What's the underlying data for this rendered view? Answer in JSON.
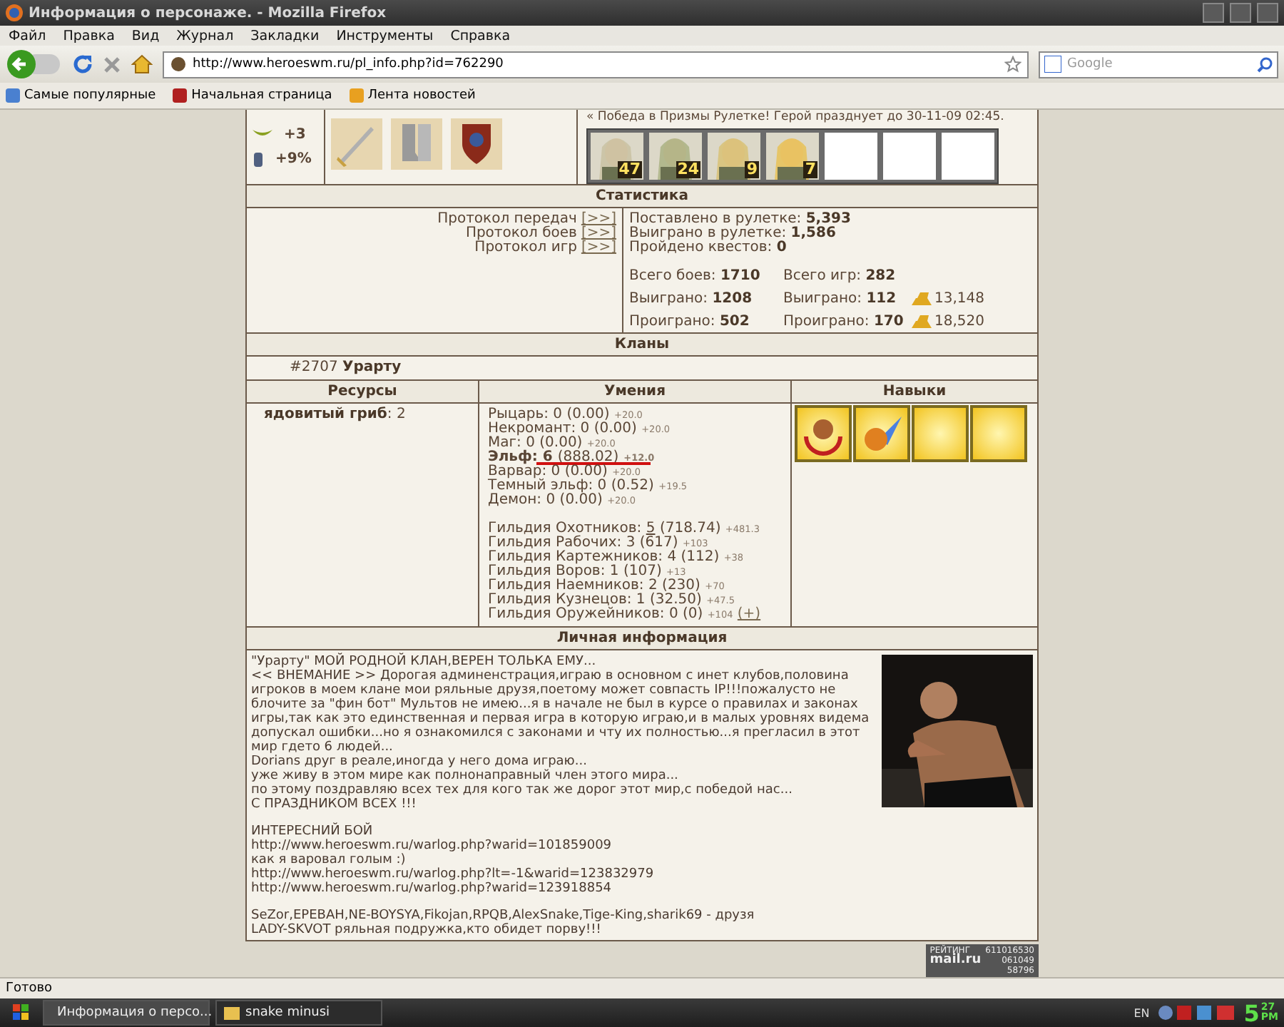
{
  "window": {
    "title": "Информация о персонаже. - Mozilla Firefox"
  },
  "menu": [
    "Файл",
    "Правка",
    "Вид",
    "Журнал",
    "Закладки",
    "Инструменты",
    "Справка"
  ],
  "nav": {
    "url": "http://www.heroeswm.ru/pl_info.php?id=762290",
    "search_placeholder": "Google"
  },
  "bookmarks": [
    "Самые популярные",
    "Начальная страница",
    "Лента новостей"
  ],
  "hero": {
    "bonuses": [
      {
        "kind": "wings",
        "value": "+3"
      },
      {
        "kind": "jar",
        "value": "+9%"
      }
    ],
    "items": [
      {
        "kind": "sword"
      },
      {
        "kind": "boots"
      },
      {
        "kind": "shield"
      }
    ],
    "news": "« Победа в Призмы Рулетке! Герой празднует до 30-11-09 02:45.",
    "army": [
      {
        "kind": "creature",
        "count": "47"
      },
      {
        "kind": "creature",
        "count": "24"
      },
      {
        "kind": "creature",
        "count": "9"
      },
      {
        "kind": "creature",
        "count": "7"
      },
      {
        "kind": "empty"
      },
      {
        "kind": "empty"
      },
      {
        "kind": "empty"
      }
    ]
  },
  "statistics": {
    "title": "Статистика",
    "links": [
      {
        "label": "Протокол передач",
        "button": "[>>]"
      },
      {
        "label": "Протокол боев",
        "button": "[>>]"
      },
      {
        "label": "Протокол игр",
        "button": "[>>]"
      }
    ],
    "roulette": [
      {
        "label": "Поставлено в рулетке:",
        "value": "5,393"
      },
      {
        "label": "Выиграно в рулетке:",
        "value": "1,586"
      },
      {
        "label": "Пройдено квестов:",
        "value": "0"
      }
    ],
    "battles": [
      {
        "cells": [
          {
            "label": "Всего боев:",
            "value": "1710"
          },
          {
            "label": "Всего игр:",
            "value": "282"
          }
        ]
      },
      {
        "cells": [
          {
            "label": "Выиграно:",
            "value": "1208"
          },
          {
            "label": "Выиграно:",
            "value": "112"
          }
        ],
        "gold": "13,148"
      },
      {
        "cells": [
          {
            "label": "Проиграно:",
            "value": "502"
          },
          {
            "label": "Проиграно:",
            "value": "170"
          }
        ],
        "gold": "18,520"
      }
    ]
  },
  "clans": {
    "title": "Кланы",
    "items": [
      {
        "id": "#2707",
        "name": "Урарту"
      }
    ]
  },
  "resources": {
    "title": "Ресурсы",
    "items": [
      {
        "name": "ядовитый гриб",
        "value": ": 2"
      }
    ]
  },
  "skills": {
    "title": "Умения",
    "factions": [
      {
        "name": "Рыцарь:",
        "level": "0",
        "points": "(0.00)",
        "bonus": "+20.0",
        "current": false
      },
      {
        "name": "Некромант:",
        "level": "0",
        "points": "(0.00)",
        "bonus": "+20.0",
        "current": false
      },
      {
        "name": "Маг:",
        "level": "0",
        "points": "(0.00)",
        "bonus": "+20.0",
        "current": false
      },
      {
        "name": "Эльф:",
        "level": "6",
        "points": "(888.02)",
        "bonus": "+12.0",
        "current": true
      },
      {
        "name": "Варвар:",
        "level": "0",
        "points": "(0.00)",
        "bonus": "+20.0",
        "current": false
      },
      {
        "name": "Темный эльф:",
        "level": "0",
        "points": "(0.52)",
        "bonus": "+19.5",
        "current": false
      },
      {
        "name": "Демон:",
        "level": "0",
        "points": "(0.00)",
        "bonus": "+20.0",
        "current": false
      }
    ],
    "guilds": [
      {
        "name": "Гильдия Охотников:",
        "level": "5",
        "points": "(718.74)",
        "bonus": "+481.3",
        "linked": true
      },
      {
        "name": "Гильдия Рабочих:",
        "level": "3",
        "points": "(617)",
        "bonus": "+103",
        "linked": false
      },
      {
        "name": "Гильдия Картежников:",
        "level": "4",
        "points": "(112)",
        "bonus": "+38",
        "linked": false
      },
      {
        "name": "Гильдия Воров:",
        "level": "1",
        "points": "(107)",
        "bonus": "+13",
        "linked": false
      },
      {
        "name": "Гильдия Наемников:",
        "level": "2",
        "points": "(230)",
        "bonus": "+70",
        "linked": false
      },
      {
        "name": "Гильдия Кузнецов:",
        "level": "1",
        "points": "(32.50)",
        "bonus": "+47.5",
        "linked": false
      },
      {
        "name": "Гильдия Оружейников:",
        "level": "0",
        "points": "(0)",
        "bonus": "+104",
        "linked": false,
        "action": "(+)"
      }
    ]
  },
  "abilities": {
    "title": "Навыки",
    "slots": [
      {
        "kind": "emblem"
      },
      {
        "kind": "fireball"
      },
      {
        "kind": "empty"
      },
      {
        "kind": "empty"
      }
    ]
  },
  "personal": {
    "title": "Личная информация",
    "photo": {
      "kind": "picture"
    },
    "paragraphs": [
      [
        "\"Урарту\" МОЙ РОДНОЙ КЛАН,ВЕРЕН ТОЛЬКА ЕМУ...",
        "<< ВНЕМАНИЕ >> Дорогая админенстрация,играю в основном с инет клубов,половина игроков в моем клане мои ряльные друзя,поетому может совпасть IP!!!пожалусто не блочите за \"фин бот\" Мультов не имею...я в начале не был в курсе о правилах и законах игры,так как это единственная и первая игра в которую играю,и в малых уровнях видема допускал ошибки...но я ознакомился с законами и чту их полностью...я прегласил в этот мир гдето 6 людей...",
        "Dorians друг в реале,иногда у него дома играю...",
        "уже живу в этом мире как полнонаправный член этого мира...",
        "по этому поздравляю всех тех для кого так же дорог этот мир,с победой нас...",
        "С ПРАЗДНИКОМ ВСЕХ !!!"
      ],
      [
        "ИНТЕРЕСНИЙ БОЙ",
        "http://www.heroeswm.ru/warlog.php?warid=101859009",
        "как я варовал голым :)",
        "http://www.heroeswm.ru/warlog.php?lt=-1&warid=123832979",
        "http://www.heroeswm.ru/warlog.php?warid=123918854"
      ],
      [
        "SeZor,EPEBAH,NE-BOYSYA,Fikojan,RPQB,AlexSnake,Tige-King,sharik69 - друзя",
        "LADY-SKVOT ряльная подружка,кто обидет порву!!!"
      ]
    ]
  },
  "counter": {
    "label": "РЕЙТИНГ",
    "number": "611016530",
    "brand": "mail.ru",
    "stats": [
      "061049",
      "58796"
    ]
  },
  "status_bar": "Готово",
  "taskbar": {
    "tasks": [
      {
        "label": "Информация о персо...",
        "kind": "browser",
        "selected": true
      },
      {
        "label": "snake minusi",
        "kind": "folder",
        "selected": false
      }
    ],
    "lang": "EN",
    "clock": {
      "hour": "5",
      "minute": "27",
      "ampm": "PM"
    }
  }
}
